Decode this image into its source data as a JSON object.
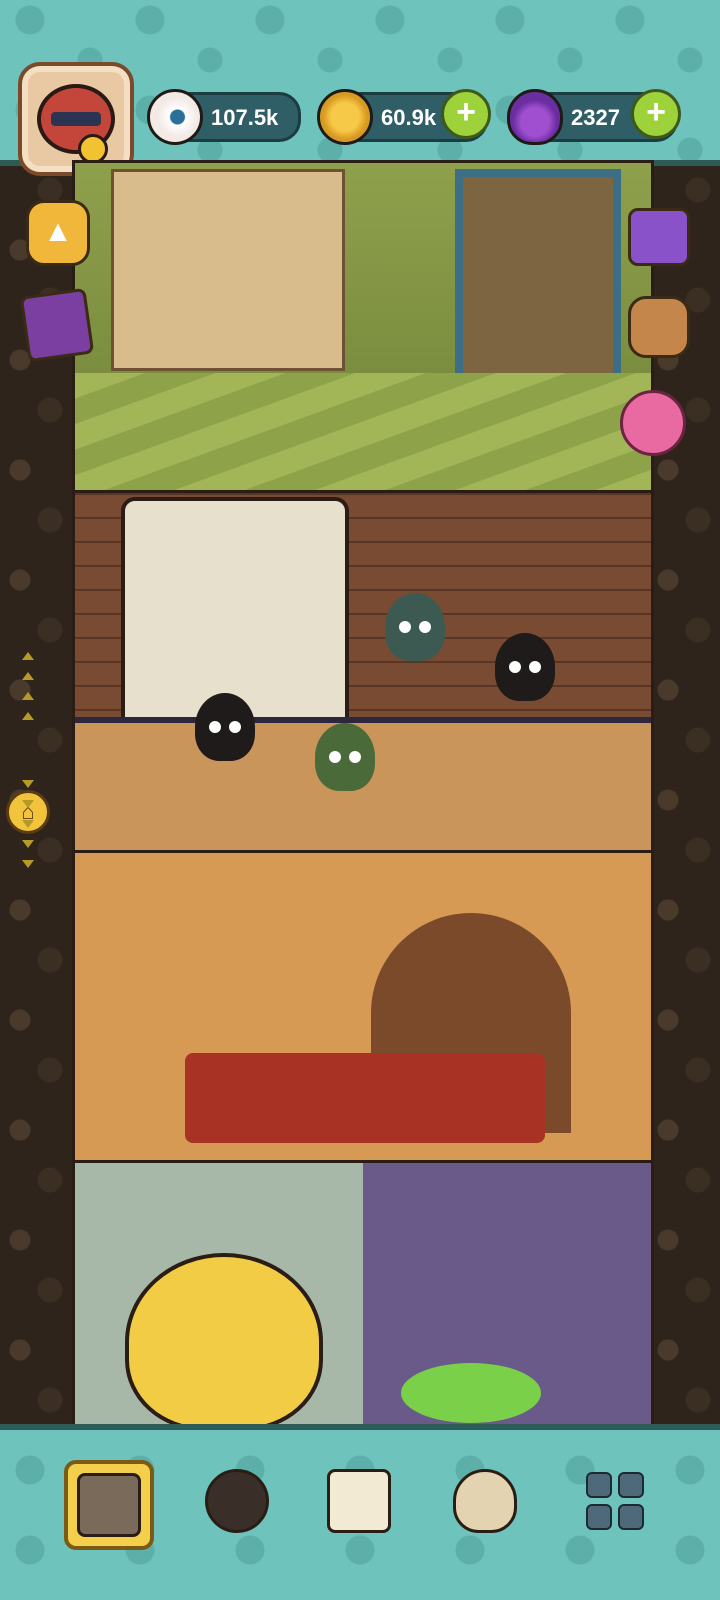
{
  "resources": {
    "eyeballs": {
      "value": "107.5k",
      "icon": "eyeball-icon"
    },
    "coins": {
      "value": "60.9k",
      "icon": "coin-icon"
    },
    "potions": {
      "value": "2327",
      "icon": "potion-icon"
    }
  },
  "side_buttons": {
    "left": [
      "collapse-up-icon",
      "cards-icon",
      "home-icon"
    ],
    "right": [
      "video-reward-icon",
      "backpack-icon",
      "eggs-icon"
    ]
  },
  "bottom_nav": {
    "active": "building-tab",
    "items": [
      "building-icon",
      "monster-icon",
      "book-icon",
      "coin-bag-icon",
      "grid-menu-icon"
    ]
  },
  "colors": {
    "hud": "#6fc3bd",
    "plus_button": "#9ed23b",
    "active_tab": "#f4cf4b"
  }
}
